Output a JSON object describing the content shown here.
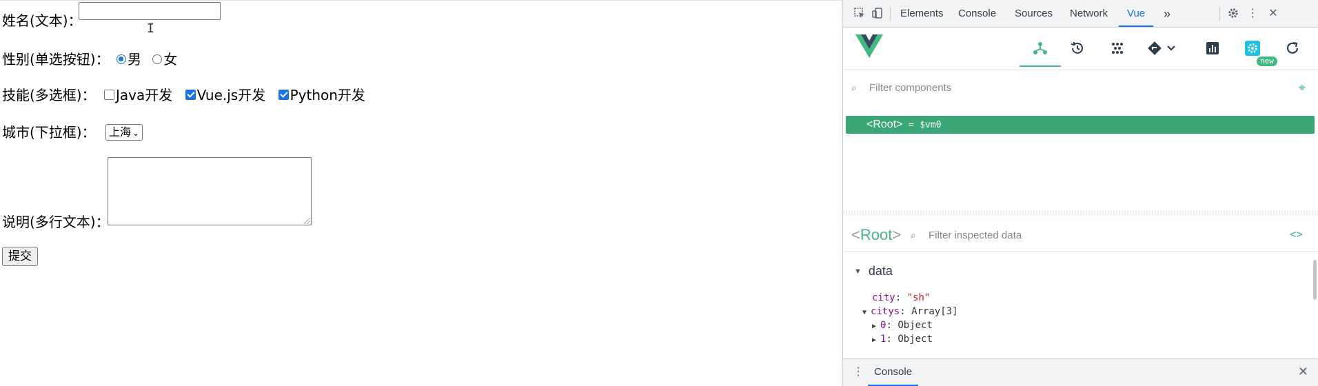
{
  "form": {
    "name_label": "姓名(文本)：",
    "name_value": "",
    "gender_label": "性别(单选按钮)：",
    "gender_options": [
      "男",
      "女"
    ],
    "gender_selected": "男",
    "skills_label": "技能(多选框)：",
    "skills": [
      {
        "label": "Java开发",
        "checked": false
      },
      {
        "label": "Vue.js开发",
        "checked": true
      },
      {
        "label": "Python开发",
        "checked": true
      }
    ],
    "city_label": "城市(下拉框)：",
    "city_selected": "上海",
    "desc_label": "说明(多行文本)：",
    "desc_value": "",
    "submit_label": "提交"
  },
  "devtools": {
    "tabs": [
      "Elements",
      "Console",
      "Sources",
      "Network",
      "Vue"
    ],
    "active_tab": "Vue",
    "more_tabs": "»",
    "vue": {
      "new_badge": "new",
      "filter_components_placeholder": "Filter components",
      "root_node_tag": "<Root>",
      "root_node_eq": "=",
      "root_node_var": "$vm0",
      "inspector_title_open": "<",
      "inspector_title_name": "Root",
      "inspector_title_close": ">",
      "filter_inspected_placeholder": "Filter inspected data",
      "data_section": "data",
      "props": [
        {
          "key": "city",
          "sep": ":",
          "value": "\"sh\""
        },
        {
          "key": "citys",
          "sep": ":",
          "value": "Array[3]"
        },
        {
          "key": "0",
          "sep": ":",
          "value": "Object"
        },
        {
          "key": "1",
          "sep": ":",
          "value": "Object"
        }
      ]
    },
    "drawer_tab": "Console",
    "accent_color": "#1a73e8",
    "vue_green": "#42b883"
  }
}
